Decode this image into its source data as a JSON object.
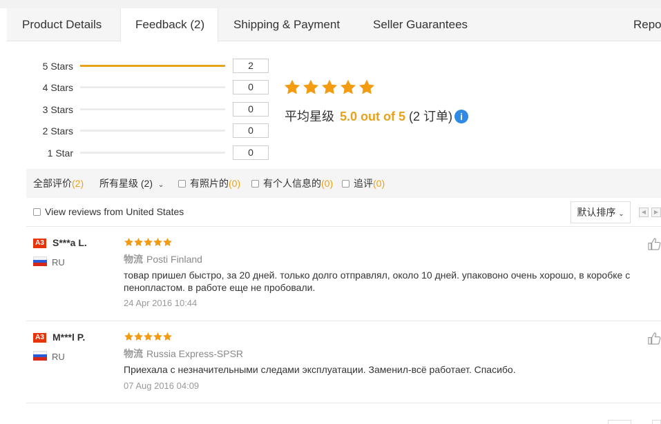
{
  "tabs": [
    {
      "label": "Product Details"
    },
    {
      "label": "Feedback (2)"
    },
    {
      "label": "Shipping & Payment"
    },
    {
      "label": "Seller Guarantees"
    },
    {
      "label": "Repor"
    }
  ],
  "histogram": [
    {
      "label": "5 Stars",
      "count": "2",
      "fraction": 1.0
    },
    {
      "label": "4 Stars",
      "count": "0",
      "fraction": 0
    },
    {
      "label": "3 Stars",
      "count": "0",
      "fraction": 0
    },
    {
      "label": "2 Stars",
      "count": "0",
      "fraction": 0
    },
    {
      "label": "1 Star",
      "count": "0",
      "fraction": 0
    }
  ],
  "summary": {
    "stars": 5,
    "prefix": "平均星级",
    "value": "5.0 out of 5",
    "orders": "(2 订单)",
    "info_icon": "info-icon"
  },
  "filters": {
    "all_label": "全部评价",
    "all_count": "(2)",
    "stars_label": "所有星级",
    "stars_count": "(2)",
    "photo_label": "有照片的",
    "photo_count": "(0)",
    "personal_label": "有个人信息的",
    "personal_count": "(0)",
    "followup_label": "追评",
    "followup_count": "(0)"
  },
  "view_from": "View reviews from United States",
  "sort_label": "默认排序",
  "reviews": [
    {
      "badge": "A3",
      "name": "S***a L.",
      "country": "RU",
      "stars": 5,
      "ship_label": "物流",
      "shipping": "Posti Finland",
      "text": "товар пришел быстро, за 20 дней. только долго отправлял, около 10 дней. упаковоно очень хорошо, в коробке с пенопластом. в работе еще не пробовали.",
      "date": "24 Apr 2016 10:44"
    },
    {
      "badge": "A3",
      "name": "M***l P.",
      "country": "RU",
      "stars": 5,
      "ship_label": "物流",
      "shipping": "Russia Express-SPSR",
      "text": "Приехала с незначительными следами эксплуатации. Заменил-всё работает. Спасибо.",
      "date": "07 Aug 2016 04:09"
    }
  ],
  "colors": {
    "accent": "#e8a21a",
    "star": "#f39c12",
    "info": "#2f8ae6",
    "badge": "#e8340a"
  }
}
